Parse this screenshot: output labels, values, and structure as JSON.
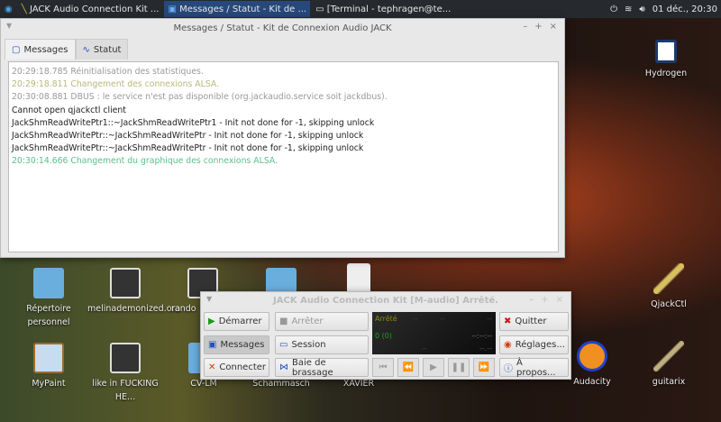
{
  "taskbar": {
    "tasks": [
      "JACK Audio Connection Kit ...",
      "Messages / Statut - Kit de ...",
      "[Terminal - tephragen@te..."
    ],
    "clock": "01 déc., 20:30"
  },
  "messages_window": {
    "title": "Messages / Statut - Kit de Connexion Audio JACK",
    "tabs": [
      "Messages",
      "Statut"
    ],
    "lines": [
      {
        "text": "20:29:18.785 Réinitialisation des statistiques.",
        "color": "#999999"
      },
      {
        "text": "20:29:18.811 Changement des connexions ALSA.",
        "color": "#b8b87a"
      },
      {
        "text": "20:30:08.881 DBUS : le service n'est pas disponible (org.jackaudio.service soit jackdbus).",
        "color": "#999999"
      },
      {
        "text": "Cannot open qjackctl client",
        "color": "#222222"
      },
      {
        "text": "JackShmReadWritePtr1::~JackShmReadWritePtr1 - Init not done for -1, skipping unlock",
        "color": "#222222"
      },
      {
        "text": "JackShmReadWritePtr::~JackShmReadWritePtr - Init not done for -1, skipping unlock",
        "color": "#222222"
      },
      {
        "text": "JackShmReadWritePtr::~JackShmReadWritePtr - Init not done for -1, skipping unlock",
        "color": "#222222"
      },
      {
        "text": "20:30:14.666 Changement du graphique des connexions ALSA.",
        "color": "#5cbf8a"
      }
    ]
  },
  "desktop": {
    "icons": [
      "Hydrogen",
      "QjackCtl",
      "Audacity",
      "guitarix",
      "Répertoire personnel",
      "melinademonized.ora",
      "rando",
      "MyPaint",
      "like in FUCKING HE...",
      "CV-LM",
      "Schammasch",
      "XAVIER"
    ]
  },
  "jack_window": {
    "title": "JACK Audio Connection Kit [M-audio] Arrêté.",
    "buttons": {
      "start": "Démarrer",
      "stop": "Arrêter",
      "messages": "Messages",
      "session": "Session",
      "connect": "Connecter",
      "patchbay": "Baie de brassage",
      "quit": "Quitter",
      "settings": "Réglages...",
      "about": "À propos..."
    },
    "display": {
      "status": "Arrêté",
      "xruns": "0 (0)",
      "time": "--:--:--",
      "d1": "--",
      "d2": "--",
      "d3": "--",
      "d4": "--",
      "d5": "--.--"
    }
  }
}
